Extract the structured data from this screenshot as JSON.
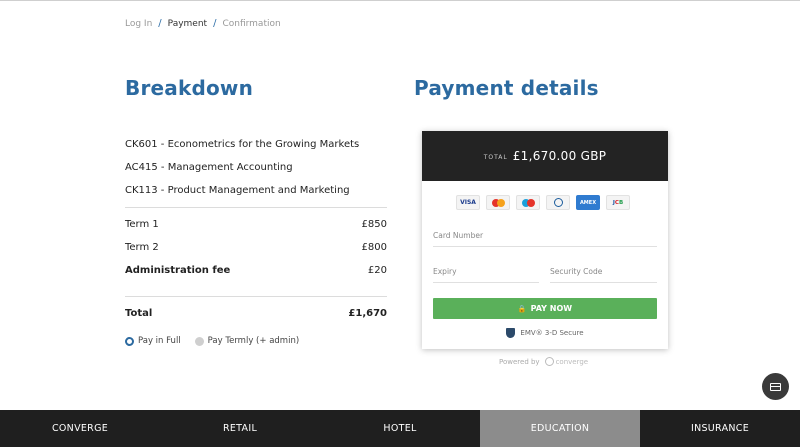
{
  "breadcrumb": [
    {
      "label": "Log In"
    },
    {
      "label": "Payment"
    },
    {
      "label": "Confirmation"
    }
  ],
  "breakdown": {
    "title": "Breakdown",
    "courses": [
      "CK601 - Econometrics for the Growing Markets",
      "AC415 - Management Accounting",
      "CK113 - Product Management and Marketing"
    ],
    "fees": [
      {
        "label": "Term 1",
        "value": "£850"
      },
      {
        "label": "Term 2",
        "value": "£800"
      },
      {
        "label": "Administration fee",
        "value": "£20"
      }
    ],
    "total": {
      "label": "Total",
      "value": "£1,670"
    },
    "payment_options": [
      {
        "label": "Pay in Full",
        "selected": true
      },
      {
        "label": "Pay Termly (+ admin)",
        "selected": false
      }
    ]
  },
  "payment": {
    "title": "Payment details",
    "total_label": "TOTAL",
    "total_amount": "£1,670.00 GBP",
    "brands": {
      "visa": "VISA",
      "amex": "AMEX",
      "jcb_j": "J",
      "jcb_c": "C",
      "jcb_b": "B"
    },
    "card_number_placeholder": "Card Number",
    "expiry_placeholder": "Expiry",
    "security_code_placeholder": "Security Code",
    "pay_button": "PAY NOW",
    "secure_text": "EMV® 3-D Secure",
    "powered_by": "Powered by",
    "powered_brand": "converge"
  },
  "footer": {
    "items": [
      {
        "label": "CONVERGE"
      },
      {
        "label": "RETAIL"
      },
      {
        "label": "HOTEL"
      },
      {
        "label": "EDUCATION"
      },
      {
        "label": "INSURANCE"
      }
    ],
    "active": "EDUCATION"
  },
  "colors": {
    "accent": "#2c6aa0",
    "pay_button": "#5ab05a",
    "header_dark": "#232323",
    "footer_bg": "#1f1f1f",
    "footer_active": "#8c8c8c"
  }
}
